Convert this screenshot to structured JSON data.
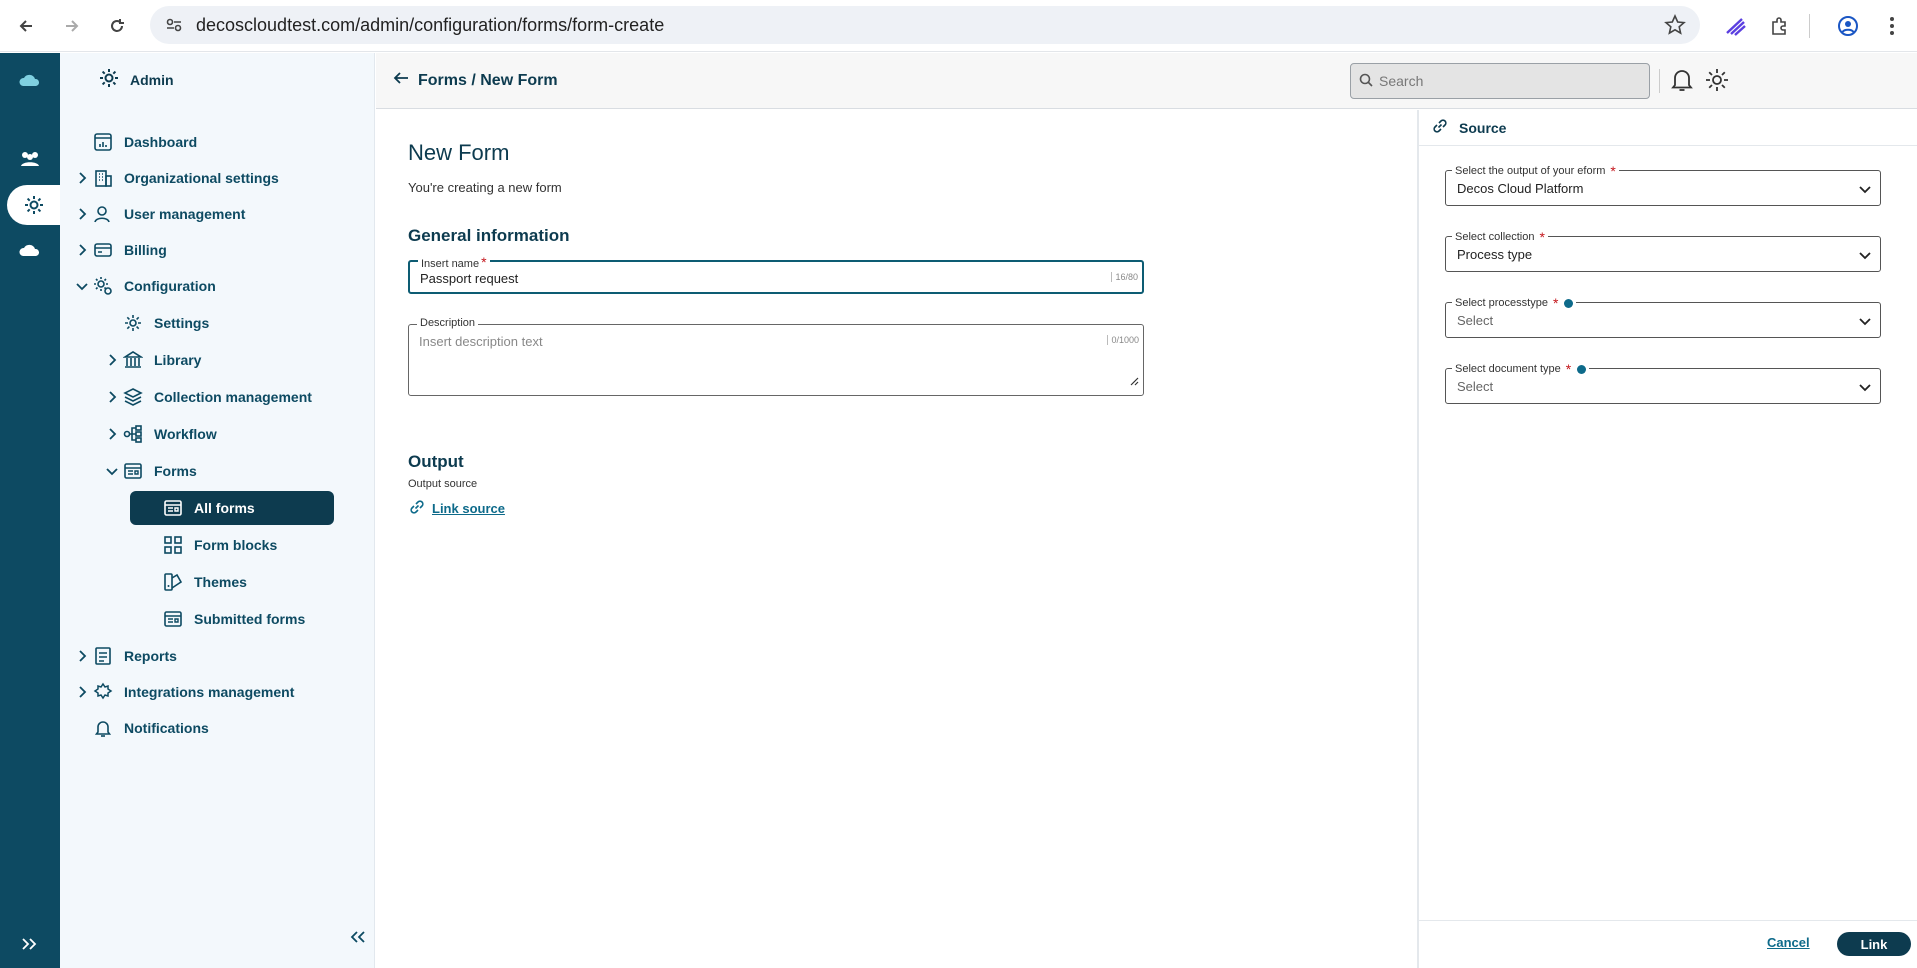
{
  "browser": {
    "url": "decoscloudtest.com/admin/configuration/forms/form-create"
  },
  "sidebar": {
    "header": "Admin",
    "items": [
      {
        "label": "Dashboard"
      },
      {
        "label": "Organizational settings"
      },
      {
        "label": "User management"
      },
      {
        "label": "Billing"
      },
      {
        "label": "Configuration"
      },
      {
        "label": "Settings"
      },
      {
        "label": "Library"
      },
      {
        "label": "Collection management"
      },
      {
        "label": "Workflow"
      },
      {
        "label": "Forms"
      },
      {
        "label": "All forms"
      },
      {
        "label": "Form blocks"
      },
      {
        "label": "Themes"
      },
      {
        "label": "Submitted forms"
      },
      {
        "label": "Reports"
      },
      {
        "label": "Integrations management"
      },
      {
        "label": "Notifications"
      }
    ]
  },
  "header": {
    "breadcrumb": "Forms / New Form",
    "search_placeholder": "Search"
  },
  "main": {
    "title": "New Form",
    "subtitle": "You're creating a new form",
    "general_title": "General information",
    "name_label": "Insert name",
    "name_value": "Passport request",
    "name_count": "16/80",
    "desc_label": "Description",
    "desc_placeholder": "Insert description text",
    "desc_count": "0/1000",
    "output_title": "Output",
    "output_source_label": "Output source",
    "link_source": "Link source"
  },
  "panel": {
    "title": "Source",
    "fields": [
      {
        "label": "Select the output of your eform",
        "value": "Decos Cloud Platform"
      },
      {
        "label": "Select collection",
        "value": "Process type"
      },
      {
        "label": "Select processtype",
        "placeholder": "Select"
      },
      {
        "label": "Select document type",
        "placeholder": "Select"
      }
    ],
    "cancel": "Cancel",
    "link": "Link"
  },
  "colors": {
    "brand_dark": "#0d3b4f",
    "rail": "#0d4a62",
    "accent": "#0d6a8a",
    "required": "#c4161c"
  }
}
